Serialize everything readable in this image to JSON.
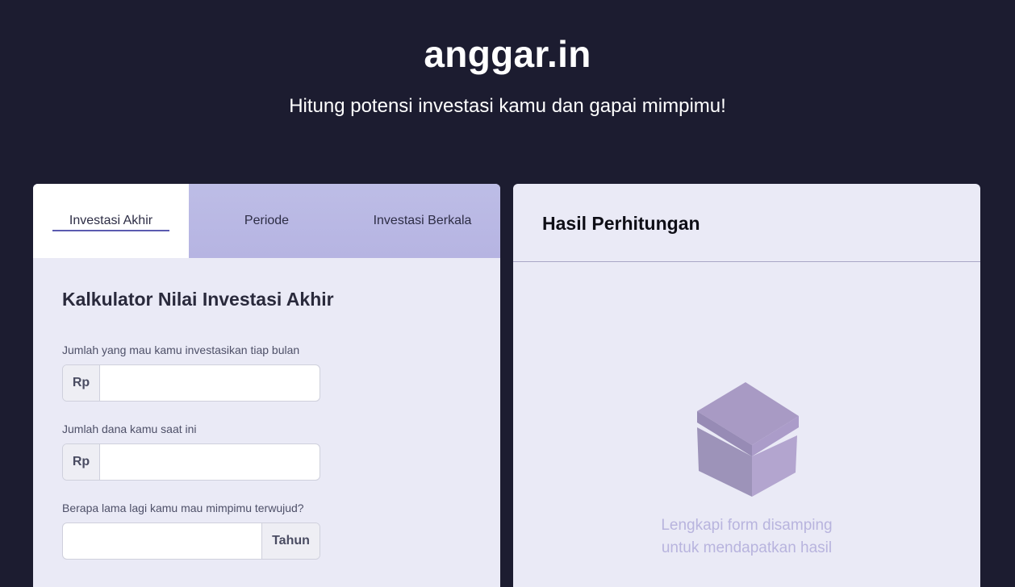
{
  "header": {
    "brand": "anggar.in",
    "tagline": "Hitung potensi investasi kamu dan gapai mimpimu!"
  },
  "tabs": [
    {
      "label": "Investasi Akhir",
      "active": true
    },
    {
      "label": "Periode",
      "active": false
    },
    {
      "label": "Investasi Berkala",
      "active": false
    }
  ],
  "form": {
    "title": "Kalkulator Nilai Investasi Akhir",
    "fields": [
      {
        "label": "Jumlah yang mau kamu investasikan tiap bulan",
        "addon": "Rp",
        "value": ""
      },
      {
        "label": "Jumlah dana kamu saat ini",
        "addon": "Rp",
        "value": ""
      },
      {
        "label": "Berapa lama lagi kamu mau mimpimu terwujud?",
        "addon": "Tahun",
        "value": ""
      }
    ]
  },
  "result": {
    "title": "Hasil Perhitungan",
    "empty_line1": "Lengkapi form disamping",
    "empty_line2": "untuk mendapatkan hasil",
    "empty_icon": "box-icon"
  },
  "colors": {
    "page_bg": "#1c1c30",
    "card_bg": "#eaeaf6",
    "tab_bar": "#b8b6e3",
    "accent": "#5b5bb0",
    "empty_text": "#b8b4de"
  }
}
